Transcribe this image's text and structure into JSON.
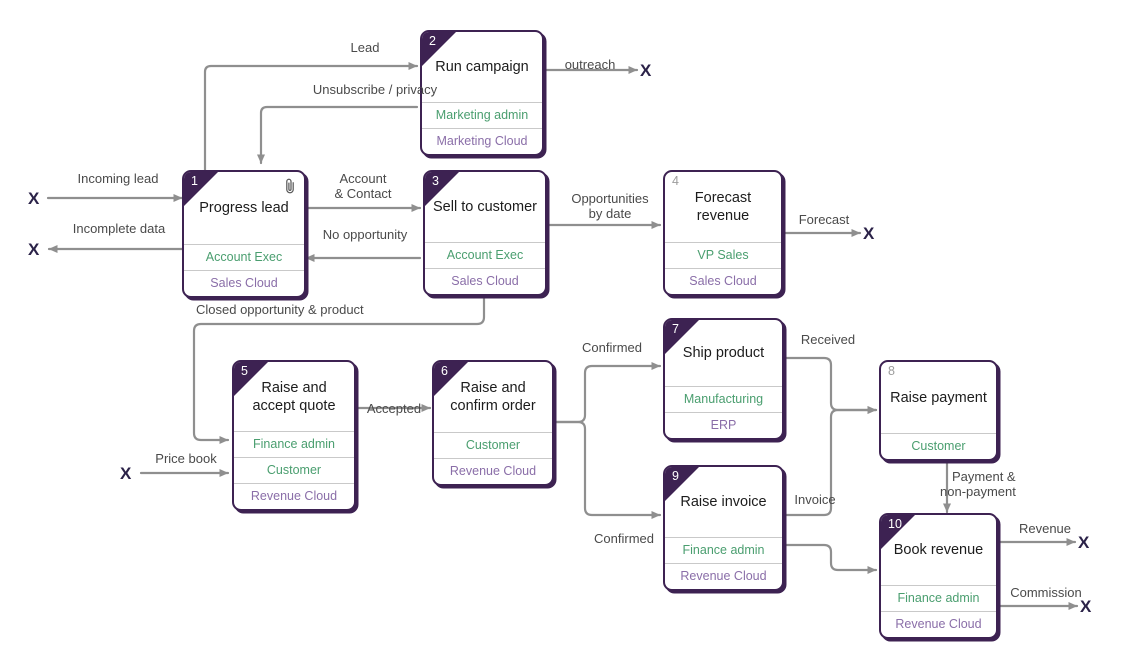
{
  "diagram": {
    "title": "Lead-to-revenue business process flow",
    "colors": {
      "node_border": "#3d2252",
      "corner": "#3d2252",
      "role_text": "#4a9e6f",
      "system_text": "#8a6ea8",
      "edge_line": "#8f8f8f",
      "terminator": "#2b2248",
      "label_text": "#4a4a4a"
    },
    "nodes": [
      {
        "id": "n1",
        "number": "1",
        "title": "Progress lead",
        "corner": true,
        "attachment_icon": "paperclip-icon",
        "lanes": [
          {
            "text": "Account Exec",
            "kind": "role"
          },
          {
            "text": "Sales Cloud",
            "kind": "sys"
          }
        ]
      },
      {
        "id": "n2",
        "number": "2",
        "title": "Run campaign",
        "corner": true,
        "attachment_icon": null,
        "lanes": [
          {
            "text": "Marketing admin",
            "kind": "role"
          },
          {
            "text": "Marketing Cloud",
            "kind": "sys"
          }
        ]
      },
      {
        "id": "n3",
        "number": "3",
        "title": "Sell to customer",
        "corner": true,
        "attachment_icon": null,
        "lanes": [
          {
            "text": "Account Exec",
            "kind": "role"
          },
          {
            "text": "Sales Cloud",
            "kind": "sys"
          }
        ]
      },
      {
        "id": "n4",
        "number": "4",
        "title": "Forecast revenue",
        "corner": false,
        "attachment_icon": null,
        "lanes": [
          {
            "text": "VP Sales",
            "kind": "role"
          },
          {
            "text": "Sales Cloud",
            "kind": "sys"
          }
        ]
      },
      {
        "id": "n5",
        "number": "5",
        "title": "Raise and accept quote",
        "corner": true,
        "attachment_icon": null,
        "lanes": [
          {
            "text": "Finance admin",
            "kind": "role"
          },
          {
            "text": "Customer",
            "kind": "role"
          },
          {
            "text": "Revenue Cloud",
            "kind": "sys"
          }
        ]
      },
      {
        "id": "n6",
        "number": "6",
        "title": "Raise and confirm order",
        "corner": true,
        "attachment_icon": null,
        "lanes": [
          {
            "text": "Customer",
            "kind": "role"
          },
          {
            "text": "Revenue Cloud",
            "kind": "sys"
          }
        ]
      },
      {
        "id": "n7",
        "number": "7",
        "title": "Ship product",
        "corner": true,
        "attachment_icon": null,
        "lanes": [
          {
            "text": "Manufacturing",
            "kind": "role"
          },
          {
            "text": "ERP",
            "kind": "sys"
          }
        ]
      },
      {
        "id": "n8",
        "number": "8",
        "title": "Raise payment",
        "corner": false,
        "attachment_icon": null,
        "lanes": [
          {
            "text": "Customer",
            "kind": "role"
          }
        ]
      },
      {
        "id": "n9",
        "number": "9",
        "title": "Raise invoice",
        "corner": true,
        "attachment_icon": null,
        "lanes": [
          {
            "text": "Finance admin",
            "kind": "role"
          },
          {
            "text": "Revenue Cloud",
            "kind": "sys"
          }
        ]
      },
      {
        "id": "n10",
        "number": "10",
        "title": "Book revenue",
        "corner": true,
        "attachment_icon": null,
        "lanes": [
          {
            "text": "Finance admin",
            "kind": "role"
          },
          {
            "text": "Revenue Cloud",
            "kind": "sys"
          }
        ]
      }
    ],
    "edges": [
      {
        "id": "e1",
        "label": "Incoming lead",
        "from": "external",
        "to": "n1"
      },
      {
        "id": "e2",
        "label": "Incomplete data",
        "from": "n1",
        "to": "external"
      },
      {
        "id": "e3",
        "label": "Lead",
        "from": "n1",
        "to": "n2"
      },
      {
        "id": "e4",
        "label": "Unsubscribe / privacy",
        "from": "n2",
        "to": "n1"
      },
      {
        "id": "e5",
        "label": "outreach",
        "from": "n2",
        "to": "external"
      },
      {
        "id": "e6",
        "label": "Account & Contact",
        "from": "n1",
        "to": "n3"
      },
      {
        "id": "e7",
        "label": "No opportunity",
        "from": "n3",
        "to": "n1"
      },
      {
        "id": "e8",
        "label": "Opportunities by date",
        "from": "n3",
        "to": "n4"
      },
      {
        "id": "e9",
        "label": "Forecast",
        "from": "n4",
        "to": "external"
      },
      {
        "id": "e10",
        "label": "Closed opportunity & product",
        "from": "n3",
        "to": "n5"
      },
      {
        "id": "e11",
        "label": "Price book",
        "from": "external",
        "to": "n5"
      },
      {
        "id": "e12",
        "label": "Accepted",
        "from": "n5",
        "to": "n6"
      },
      {
        "id": "e13",
        "label": "Confirmed",
        "from": "n6",
        "to": "n7"
      },
      {
        "id": "e14",
        "label": "Confirmed",
        "from": "n6",
        "to": "n9"
      },
      {
        "id": "e15",
        "label": "Received",
        "from": "n7",
        "to": "n8"
      },
      {
        "id": "e16",
        "label": "Invoice",
        "from": "n9",
        "to": "n8"
      },
      {
        "id": "e17",
        "label": "Payment & non-payment",
        "from": "n8",
        "to": "n10"
      },
      {
        "id": "e18",
        "label": "Revenue",
        "from": "n10",
        "to": "external"
      },
      {
        "id": "e19",
        "label": "Commission",
        "from": "n10",
        "to": "external"
      }
    ],
    "terminators": [
      {
        "id": "t1",
        "symbol": "X"
      },
      {
        "id": "t2",
        "symbol": "X"
      },
      {
        "id": "t3",
        "symbol": "X"
      },
      {
        "id": "t4",
        "symbol": "X"
      },
      {
        "id": "t5",
        "symbol": "X"
      },
      {
        "id": "t6",
        "symbol": "X"
      },
      {
        "id": "t7",
        "symbol": "X"
      }
    ],
    "label_lines": {
      "incoming_lead": "Incoming lead",
      "incomplete_data": "Incomplete data",
      "lead": "Lead",
      "unsubscribe": "Unsubscribe / privacy",
      "outreach": "outreach",
      "account_l1": "Account",
      "account_l2": "& Contact",
      "no_opportunity": "No opportunity",
      "opps_l1": "Opportunities",
      "opps_l2": "by date",
      "forecast": "Forecast",
      "closed_opp": "Closed opportunity & product",
      "price_book": "Price book",
      "accepted": "Accepted",
      "confirmed_top": "Confirmed",
      "confirmed_bottom": "Confirmed",
      "received": "Received",
      "invoice": "Invoice",
      "payment_l1": "Payment &",
      "payment_l2": "non-payment",
      "revenue": "Revenue",
      "commission": "Commission"
    }
  }
}
